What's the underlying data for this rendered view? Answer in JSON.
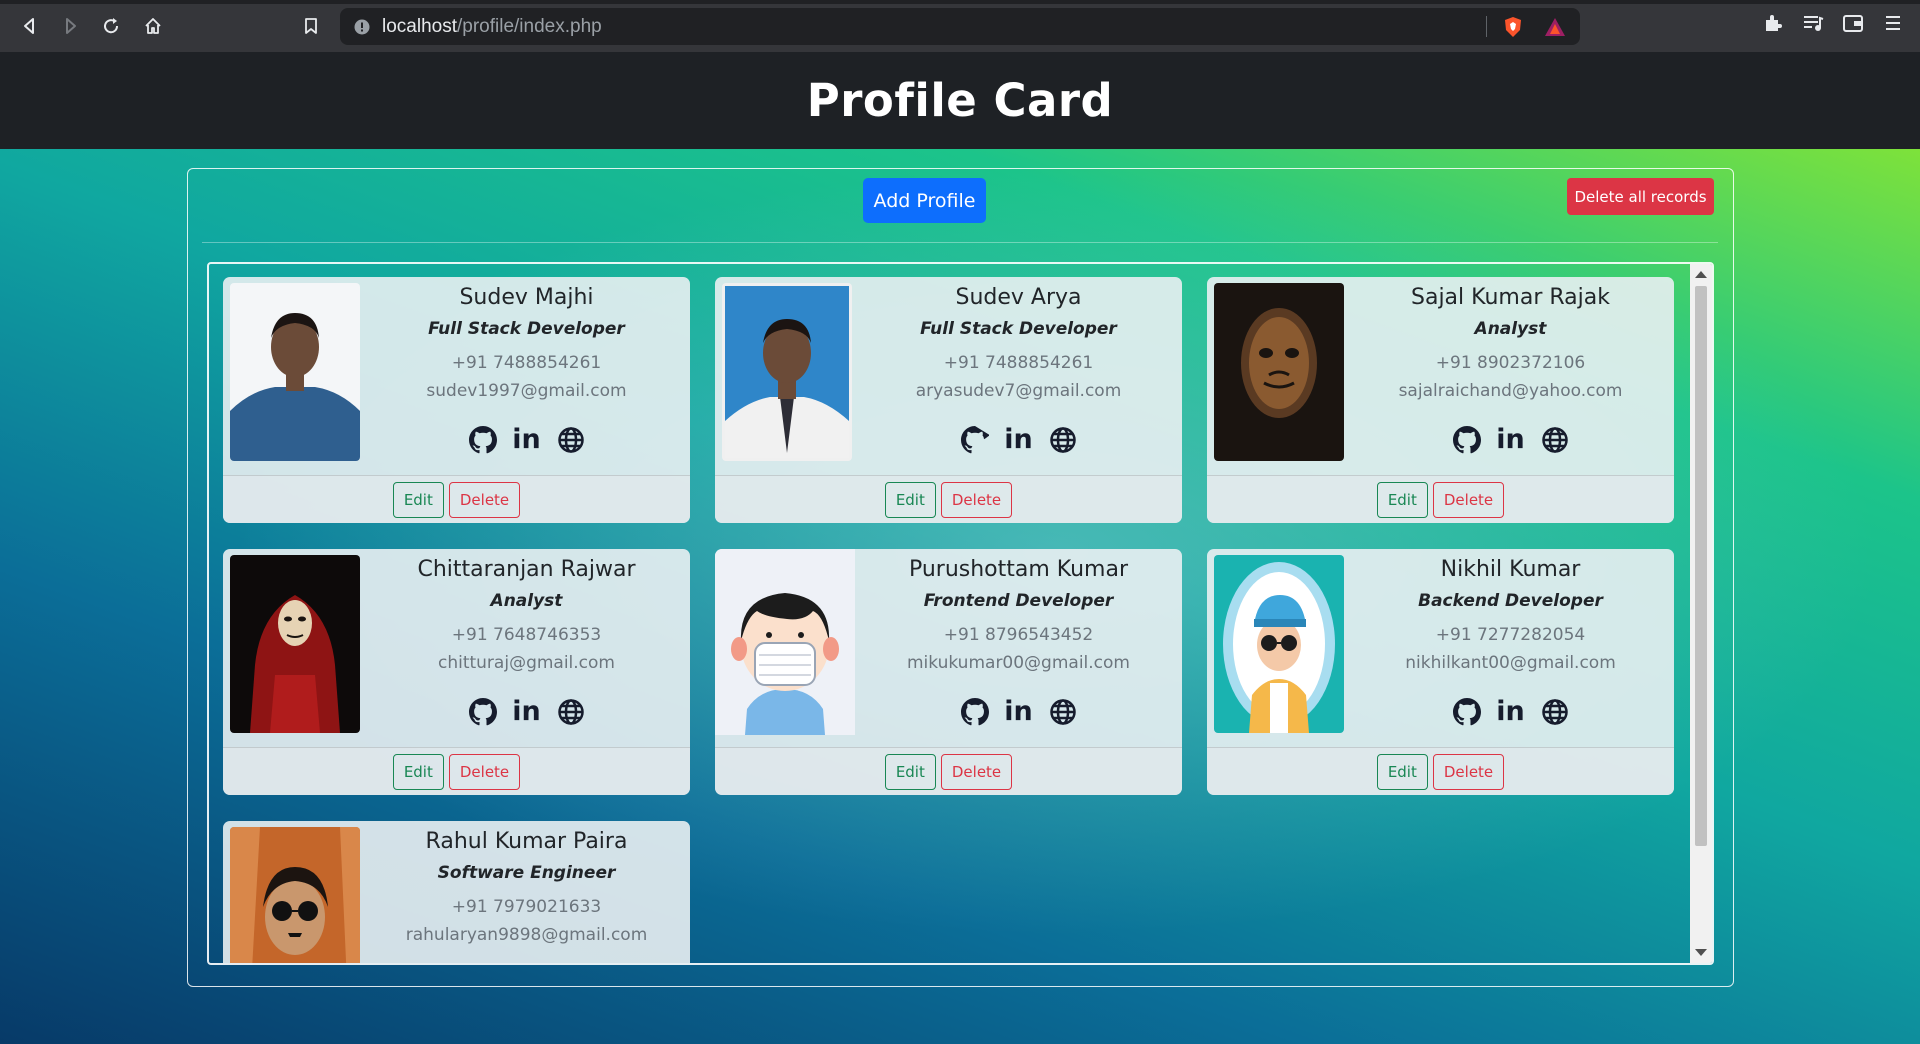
{
  "browser": {
    "url_host": "localhost",
    "url_path": "/profile/index.php"
  },
  "page": {
    "title": "Profile Card",
    "add_button": "Add Profile",
    "delete_all_button": "Delete all records"
  },
  "card_actions": {
    "edit": "Edit",
    "delete": "Delete"
  },
  "profiles": [
    {
      "name": "Sudev Majhi",
      "role": "Full Stack Developer",
      "phone": "+91 7488854261",
      "email": "sudev1997@gmail.com",
      "avatar": "man-blue-shirt-photo"
    },
    {
      "name": "Sudev Arya",
      "role": "Full Stack Developer",
      "phone": "+91 7488854261",
      "email": "aryasudev7@gmail.com",
      "avatar": "passport-photo-tie"
    },
    {
      "name": "Sajal Kumar Rajak",
      "role": "Analyst",
      "phone": "+91 8902372106",
      "email": "sajalraichand@yahoo.com",
      "avatar": "mask-dark"
    },
    {
      "name": "Chittaranjan Rajwar",
      "role": "Analyst",
      "phone": "+91 7648746353",
      "email": "chitturaj@gmail.com",
      "avatar": "red-hood-mask"
    },
    {
      "name": "Purushottam Kumar",
      "role": "Frontend Developer",
      "phone": "+91 8796543452",
      "email": "mikukumar00@gmail.com",
      "avatar": "cartoon-face-mask"
    },
    {
      "name": "Nikhil Kumar",
      "role": "Backend Developer",
      "phone": "+91 7277282054",
      "email": "nikhilkant00@gmail.com",
      "avatar": "cartoon-cap-sunglasses"
    },
    {
      "name": "Rahul Kumar Paira",
      "role": "Software Engineer",
      "phone": "+91 7979021633",
      "email": "rahularyan9898@gmail.com",
      "avatar": "sunglasses-mustache-photo"
    }
  ],
  "icons": {
    "github": "github-icon",
    "linkedin": "linkedin-icon",
    "website": "globe-icon"
  },
  "colors": {
    "primary": "#0d6efd",
    "danger": "#dc3545",
    "success": "#198754",
    "header_bg": "#1e2125"
  }
}
